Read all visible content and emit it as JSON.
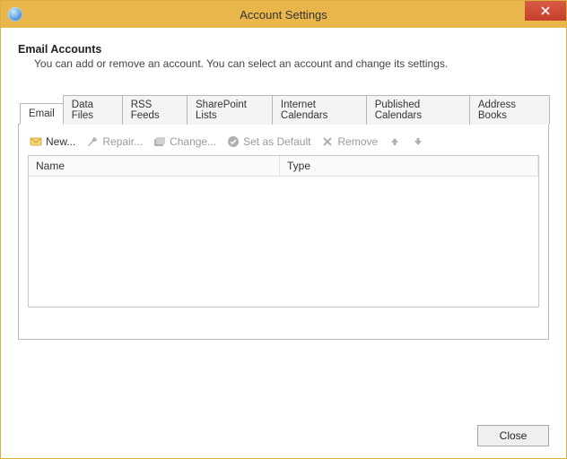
{
  "window": {
    "title": "Account Settings"
  },
  "header": {
    "heading": "Email Accounts",
    "subheading": "You can add or remove an account. You can select an account and change its settings."
  },
  "tabs": {
    "items": [
      {
        "label": "Email",
        "active": true
      },
      {
        "label": "Data Files"
      },
      {
        "label": "RSS Feeds"
      },
      {
        "label": "SharePoint Lists"
      },
      {
        "label": "Internet Calendars"
      },
      {
        "label": "Published Calendars"
      },
      {
        "label": "Address Books"
      }
    ]
  },
  "toolbar": {
    "new_label": "New...",
    "repair_label": "Repair...",
    "change_label": "Change...",
    "default_label": "Set as Default",
    "remove_label": "Remove"
  },
  "table": {
    "columns": {
      "name": "Name",
      "type": "Type"
    },
    "rows": []
  },
  "footer": {
    "close_label": "Close"
  }
}
